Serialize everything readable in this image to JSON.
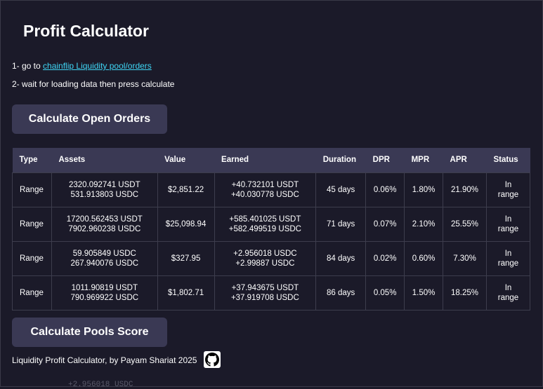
{
  "title": "Profit Calculator",
  "instructions": {
    "step1_prefix": "1- go to ",
    "step1_link": "chainflip Liquidity pool/orders",
    "step2": "2- wait for loading data then press calculate"
  },
  "buttons": {
    "calculate_orders": "Calculate Open Orders",
    "calculate_pools": "Calculate Pools Score"
  },
  "table": {
    "headers": [
      "Type",
      "Assets",
      "Value",
      "Earned",
      "Duration",
      "DPR",
      "MPR",
      "APR",
      "Status"
    ],
    "rows": [
      {
        "type": "Range",
        "assets": [
          "2320.092741 USDT",
          "531.913803 USDC"
        ],
        "value": "$2,851.22",
        "earned": [
          "+40.732101 USDT",
          "+40.030778 USDC"
        ],
        "duration": "45 days",
        "dpr": "0.06%",
        "mpr": "1.80%",
        "apr": "21.90%",
        "status": [
          "In",
          "range"
        ]
      },
      {
        "type": "Range",
        "assets": [
          "17200.562453 USDT",
          "7902.960238 USDC"
        ],
        "value": "$25,098.94",
        "earned": [
          "+585.401025 USDT",
          "+582.499519 USDC"
        ],
        "duration": "71 days",
        "dpr": "0.07%",
        "mpr": "2.10%",
        "apr": "25.55%",
        "status": [
          "In",
          "range"
        ]
      },
      {
        "type": "Range",
        "assets": [
          "59.905849 USDC",
          "267.940076 USDC"
        ],
        "value": "$327.95",
        "earned": [
          "+2.956018 USDC",
          "+2.99887 USDC"
        ],
        "duration": "84 days",
        "dpr": "0.02%",
        "mpr": "0.60%",
        "apr": "7.30%",
        "status": [
          "In",
          "range"
        ]
      },
      {
        "type": "Range",
        "assets": [
          "1011.90819 USDT",
          "790.969922 USDC"
        ],
        "value": "$1,802.71",
        "earned": [
          "+37.943675 USDT",
          "+37.919708 USDC"
        ],
        "duration": "86 days",
        "dpr": "0.05%",
        "mpr": "1.50%",
        "apr": "18.25%",
        "status": [
          "In",
          "range"
        ]
      }
    ]
  },
  "footer": "Liquidity Profit Calculator, by Payam Shariat 2025",
  "icons": {
    "github": "github-icon"
  },
  "background_fragment": "+2.956018 USDC",
  "colors": {
    "background": "#1b1a29",
    "button": "#3a3954",
    "link": "#3fd6f5"
  }
}
